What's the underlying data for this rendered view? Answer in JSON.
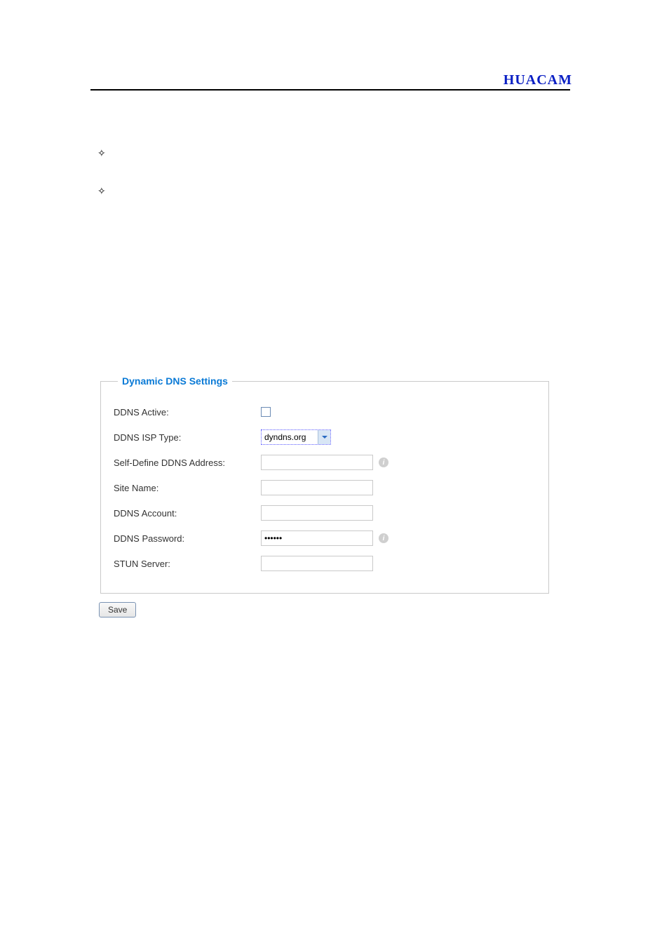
{
  "brand": "HUACAM",
  "ddns": {
    "legend": "Dynamic DNS Settings",
    "active_label": "DDNS Active:",
    "isp_label": "DDNS ISP Type:",
    "isp_value": "dyndns.org",
    "self_addr_label": "Self-Define DDNS Address:",
    "self_addr_value": "",
    "site_label": "Site Name:",
    "site_value": "",
    "account_label": "DDNS Account:",
    "account_value": "",
    "password_label": "DDNS Password:",
    "password_value": "••••••",
    "stun_label": "STUN Server:",
    "stun_value": ""
  },
  "save_label": "Save",
  "info_glyph": "i",
  "bullet_glyph": "✧"
}
